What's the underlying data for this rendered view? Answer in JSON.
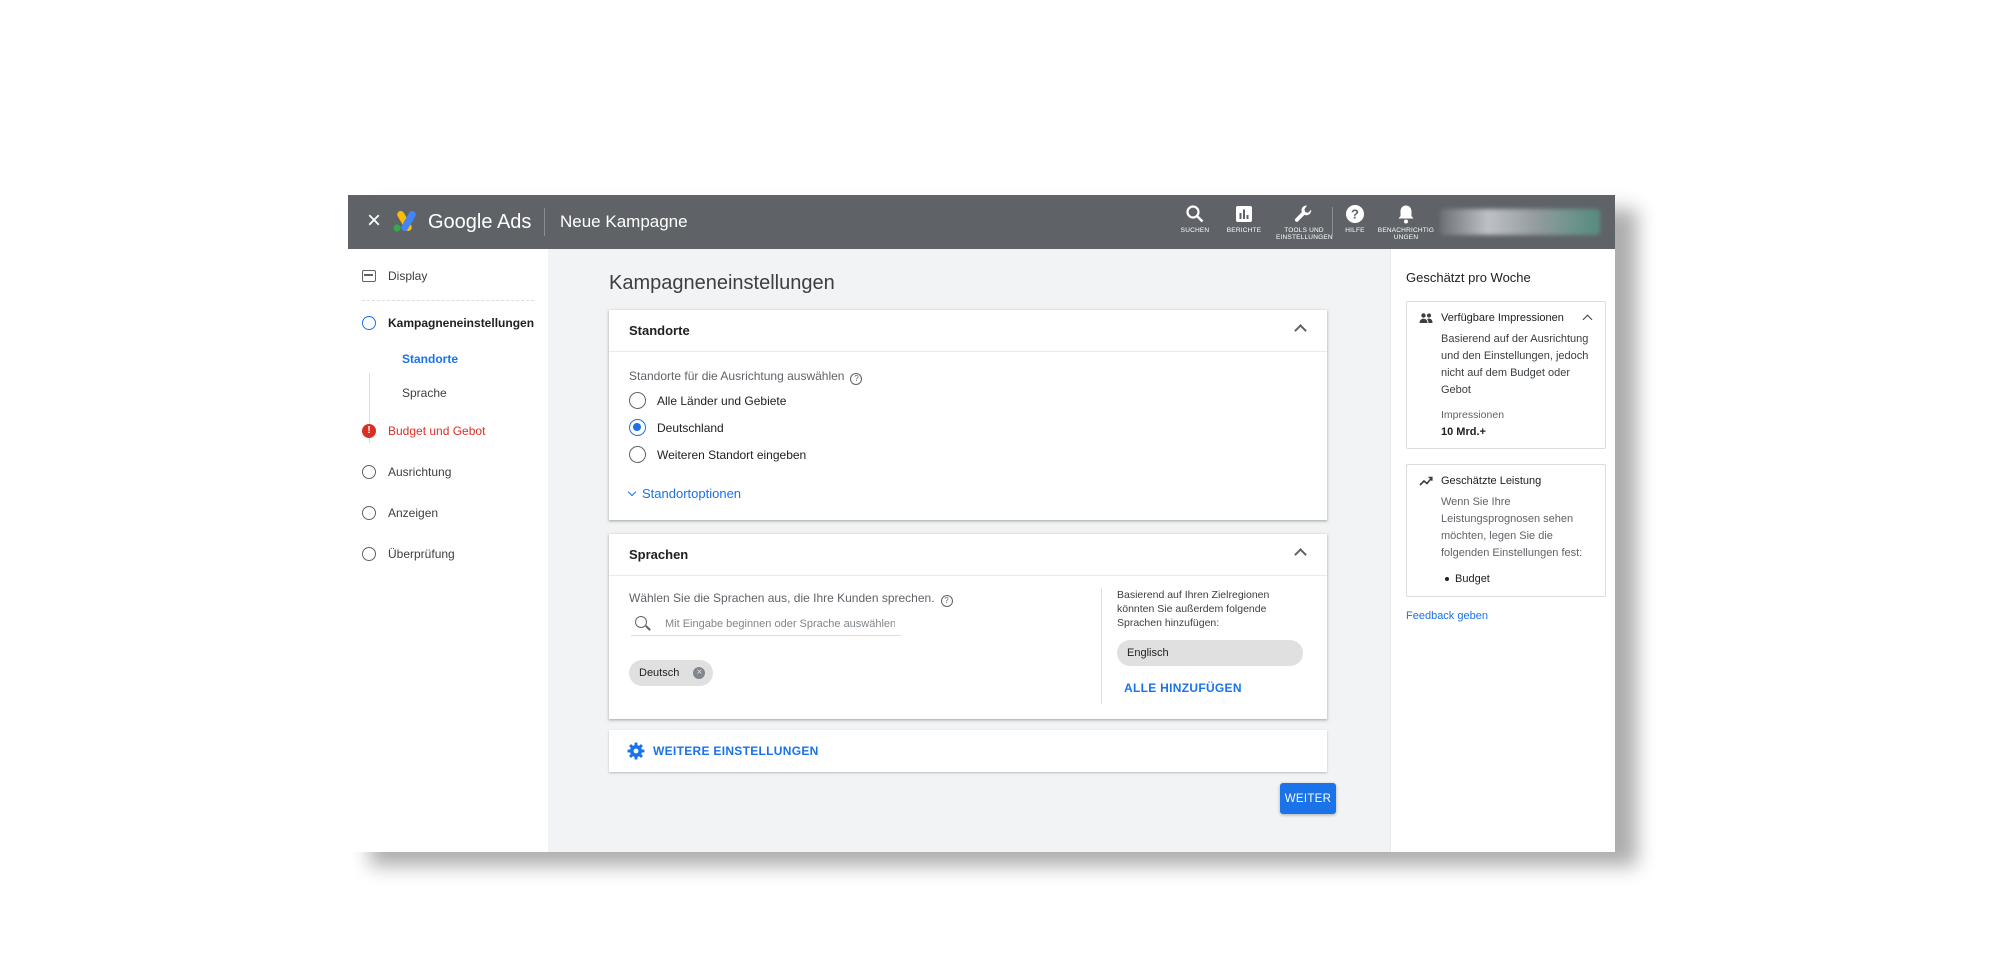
{
  "topbar": {
    "close_icon": "close-icon",
    "brand": "Google Ads",
    "page_name": "Neue Kampagne",
    "colors": {
      "bar": "#5f6368",
      "accent": "#1a73e8"
    },
    "items": [
      {
        "icon": "search-icon",
        "label": "SUCHEN"
      },
      {
        "icon": "reports-icon",
        "label": "BERICHTE"
      },
      {
        "icon": "wrench-icon",
        "label_1": "TOOLS UND",
        "label_2": "EINSTELLUNGEN"
      },
      {
        "icon": "help-icon",
        "label": "HILFE"
      },
      {
        "icon": "bell-icon",
        "label_1": "BENACHRICHTIG",
        "label_2": "UNGEN"
      }
    ]
  },
  "leftnav": {
    "display_label": "Display",
    "steps": [
      {
        "label": "Kampagneneinstellungen",
        "state": "active"
      },
      {
        "label": "Budget und Gebot",
        "state": "error"
      },
      {
        "label": "Ausrichtung",
        "state": "todo"
      },
      {
        "label": "Anzeigen",
        "state": "todo"
      },
      {
        "label": "Überprüfung",
        "state": "todo"
      }
    ],
    "substeps": [
      {
        "label": "Standorte",
        "active": true
      },
      {
        "label": "Sprache",
        "active": false
      }
    ]
  },
  "main": {
    "title": "Kampagneneinstellungen",
    "locations": {
      "title": "Standorte",
      "field_label": "Standorte für die Ausrichtung auswählen",
      "options": [
        {
          "label": "Alle Länder und Gebiete",
          "checked": false
        },
        {
          "label": "Deutschland",
          "checked": true
        },
        {
          "label": "Weiteren Standort eingeben",
          "checked": false
        }
      ],
      "options_link": "Standortoptionen"
    },
    "languages": {
      "title": "Sprachen",
      "field_label": "Wählen Sie die Sprachen aus, die Ihre Kunden sprechen.",
      "search_placeholder": "Mit Eingabe beginnen oder Sprache auswählen",
      "selected_chip": "Deutsch",
      "suggestion_text": "Basierend auf Ihren Zielregionen könnten Sie außerdem folgende Sprachen hinzufügen:",
      "suggestion_chip": "Englisch",
      "add_all": "ALLE HINZUFÜGEN"
    },
    "more_settings": "WEITERE EINSTELLUNGEN",
    "next_button": "WEITER"
  },
  "rightpanel": {
    "title": "Geschätzt pro Woche",
    "impressions": {
      "heading": "Verfügbare Impressionen",
      "body": "Basierend auf der Ausrichtung und den Einstellungen, jedoch nicht auf dem Budget oder Gebot",
      "metric_label": "Impressionen",
      "metric_value": "10 Mrd.+"
    },
    "performance": {
      "heading": "Geschätzte Leistung",
      "body": "Wenn Sie Ihre Leistungsprognosen sehen möchten, legen Sie die folgenden Einstellungen fest:",
      "bullet": "Budget"
    },
    "feedback": "Feedback geben"
  }
}
